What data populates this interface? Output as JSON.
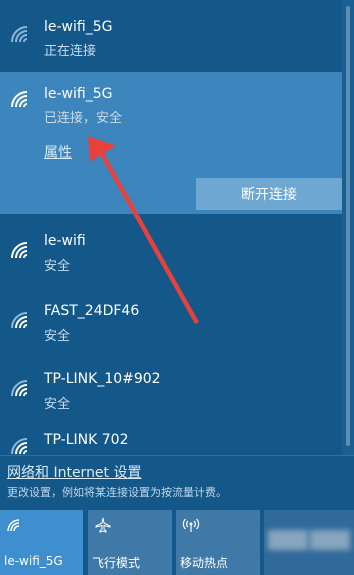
{
  "networks": [
    {
      "name": "le-wifi_5G",
      "status": "正在连接"
    },
    {
      "name": "le-wifi_5G",
      "status": "已连接，安全",
      "properties_link": "属性",
      "disconnect_label": "断开连接"
    },
    {
      "name": "le-wifi",
      "status": "安全"
    },
    {
      "name": "FAST_24DF46",
      "status": "安全"
    },
    {
      "name": "TP-LINK_10#902",
      "status": "安全"
    },
    {
      "name": "TP-LINK 702",
      "status": ""
    }
  ],
  "settings": {
    "link": "网络和 Internet 设置",
    "description": "更改设置，例如将某连接设置为按流量计费。"
  },
  "quick_actions": [
    {
      "label": "le-wifi_5G",
      "icon": "wifi-icon",
      "active": true
    },
    {
      "label": "飞行模式",
      "icon": "airplane-icon",
      "active": false
    },
    {
      "label": "移动热点",
      "icon": "hotspot-icon",
      "active": false
    },
    {
      "label": "",
      "icon": "",
      "active": false
    }
  ],
  "colors": {
    "panel_bg": "#14588a",
    "selected_bg": "#3d85bd",
    "button_bg": "#6ea7d2",
    "annotation_arrow": "#e8413b"
  }
}
